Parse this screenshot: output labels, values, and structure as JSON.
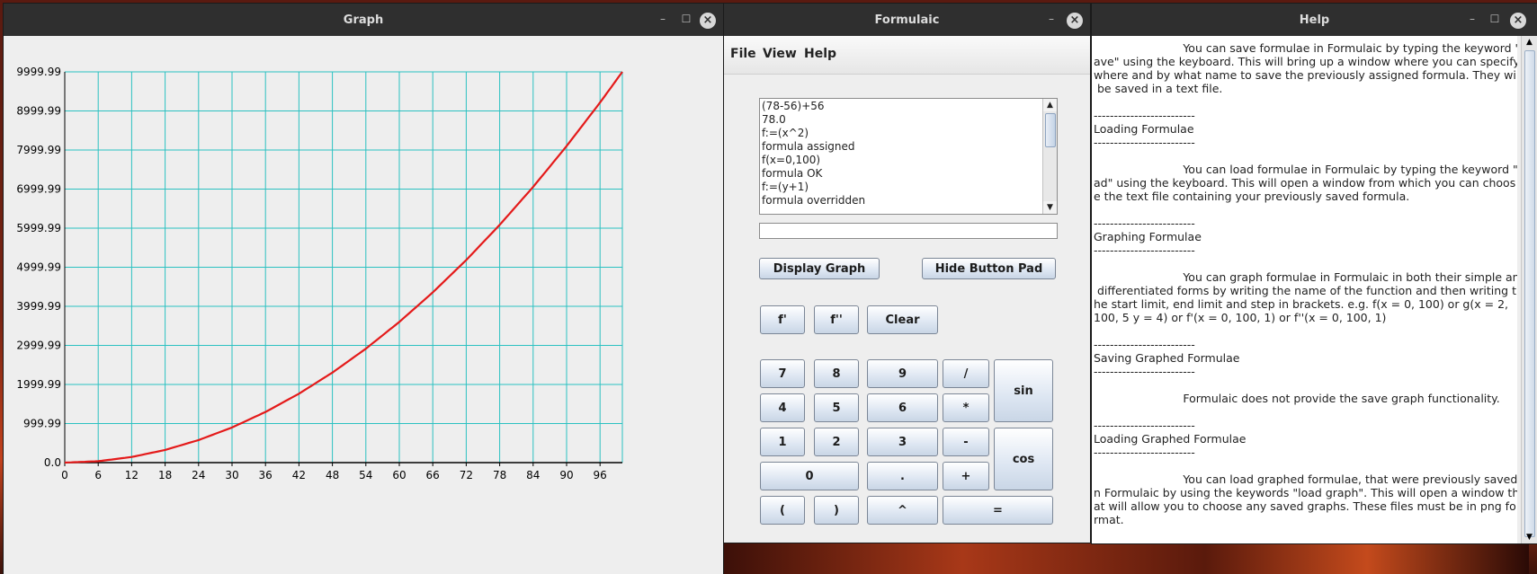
{
  "graph": {
    "title": "Graph",
    "y_ticks": [
      "9999.99",
      "8999.99",
      "7999.99",
      "6999.99",
      "5999.99",
      "4999.99",
      "3999.99",
      "2999.99",
      "1999.99",
      "999.99",
      "0.0"
    ],
    "x_ticks": [
      "0",
      "6",
      "12",
      "18",
      "24",
      "30",
      "36",
      "42",
      "48",
      "54",
      "60",
      "66",
      "72",
      "78",
      "84",
      "90",
      "96"
    ],
    "grid_color": "#2bc1c1",
    "curve_color": "#e41a1a"
  },
  "chart_data": {
    "type": "line",
    "title": "",
    "xlabel": "",
    "ylabel": "",
    "xlim": [
      0,
      100
    ],
    "ylim": [
      0,
      10000
    ],
    "grid": true,
    "series": [
      {
        "x": [
          0,
          6,
          12,
          18,
          24,
          30,
          36,
          42,
          48,
          54,
          60,
          66,
          72,
          78,
          84,
          90,
          96,
          100
        ],
        "y": [
          0,
          36,
          144,
          324,
          576,
          900,
          1296,
          1764,
          2304,
          2916,
          3600,
          4356,
          5184,
          6084,
          7056,
          8100,
          9216,
          10000
        ]
      }
    ]
  },
  "formulaic": {
    "title": "Formulaic",
    "menu": [
      "File",
      "View",
      "Help"
    ],
    "output_lines": [
      "(78-56)+56",
      "78.0",
      "f:=(x^2)",
      "formula assigned",
      "f(x=0,100)",
      "formula OK",
      "f:=(y+1)",
      "formula overridden"
    ],
    "input_value": "",
    "buttons": {
      "display_graph": "Display Graph",
      "hide_button_pad": "Hide Button Pad",
      "f_prime": "f'",
      "f_double_prime": "f''",
      "clear": "Clear",
      "seven": "7",
      "eight": "8",
      "nine": "9",
      "divide": "/",
      "four": "4",
      "five": "5",
      "six": "6",
      "multiply": "*",
      "one": "1",
      "two": "2",
      "three": "3",
      "minus": "-",
      "zero": "0",
      "dot": ".",
      "plus": "+",
      "lparen": "(",
      "rparen": ")",
      "caret": "^",
      "equals": "=",
      "sin": "sin",
      "cos": "cos"
    }
  },
  "help": {
    "title": "Help",
    "lines": [
      "                         You can save formulae in Formulaic by typing the keyword \"s",
      "ave\" using the keyboard. This will bring up a window where you can specify",
      "where and by what name to save the previously assigned formula. They will",
      " be saved in a text file.",
      "",
      "-------------------------",
      "Loading Formulae",
      "-------------------------",
      "",
      "                         You can load formulae in Formulaic by typing the keyword \"lo",
      "ad\" using the keyboard. This will open a window from which you can choos",
      "e the text file containing your previously saved formula.",
      "",
      "-------------------------",
      "Graphing Formulae",
      "-------------------------",
      "",
      "                         You can graph formulae in Formulaic in both their simple and",
      " differentiated forms by writing the name of the function and then writing t",
      "he start limit, end limit and step in brackets. e.g. f(x = 0, 100) or g(x = 2,",
      "100, 5 y = 4) or f'(x = 0, 100, 1) or f''(x = 0, 100, 1)",
      "",
      "-------------------------",
      "Saving Graphed Formulae",
      "-------------------------",
      "",
      "                         Formulaic does not provide the save graph functionality.",
      "",
      "-------------------------",
      "Loading Graphed Formulae",
      "-------------------------",
      "",
      "                         You can load graphed formulae, that were previously saved, i",
      "n Formulaic by using the keywords \"load graph\". This will open a window th",
      "at will allow you to choose any saved graphs. These files must be in png fo",
      "rmat."
    ]
  }
}
